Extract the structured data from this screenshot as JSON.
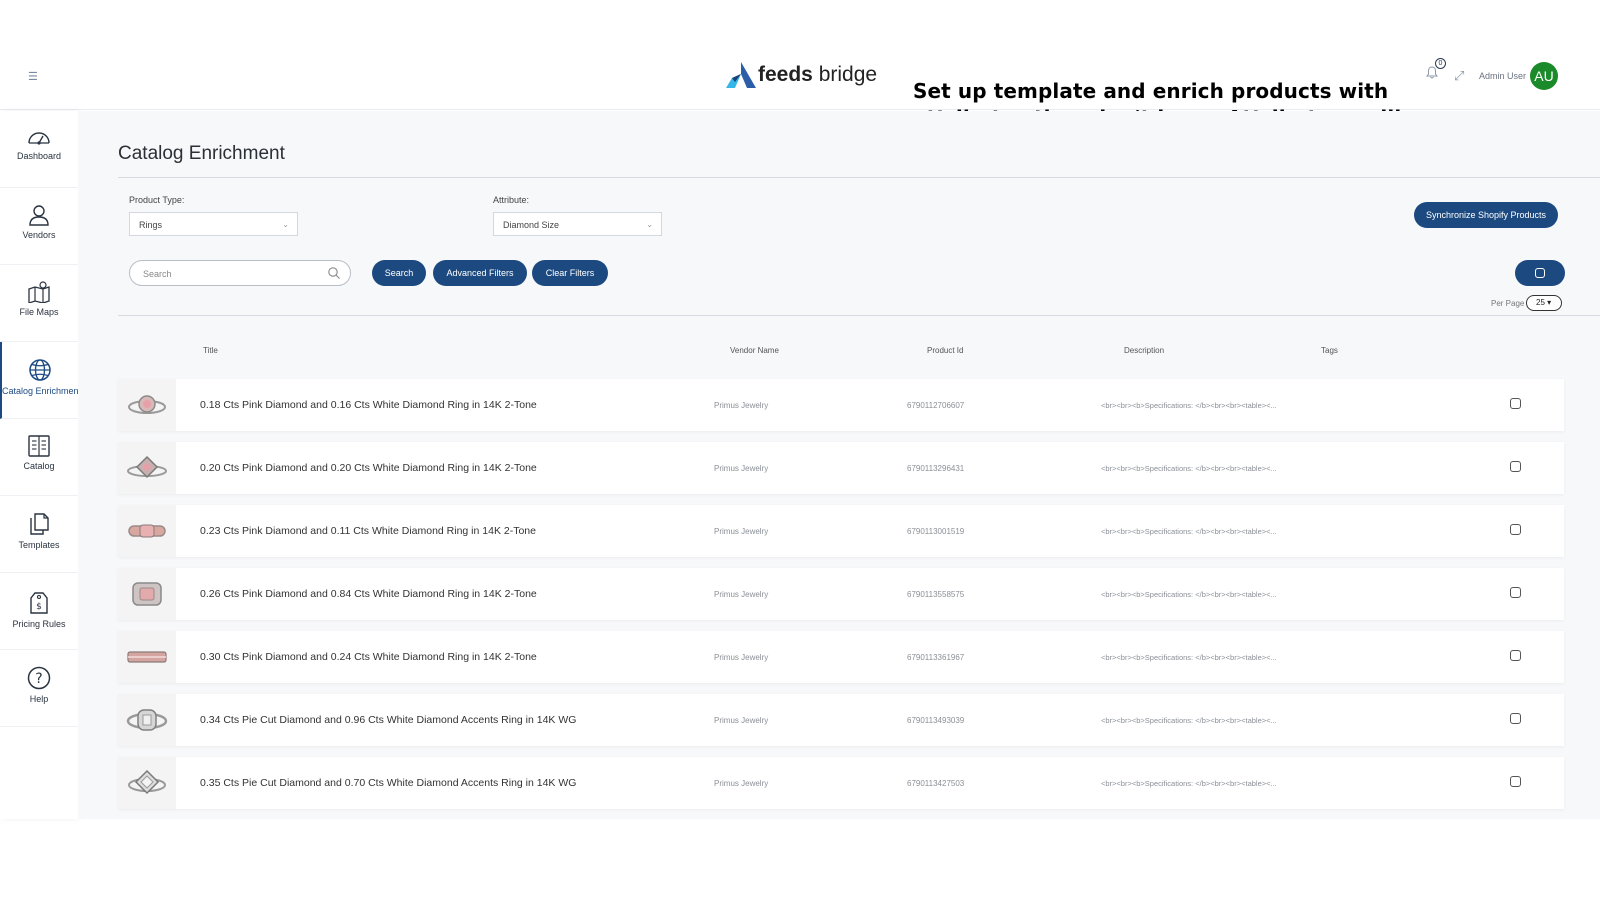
{
  "header": {
    "logo_strong": "feeds",
    "logo_light": " bridge",
    "annotation": "Set up template and enrich products with attributes they don't have. Attributess will  be created as tags on shopify in the following format \"Diamond Size_1-2Ctw\". This enrichment will make your products more visible on products listing page.",
    "notification_count": "0",
    "user_name": "Admin User",
    "user_initials": "AU"
  },
  "sidebar": {
    "items": [
      {
        "label": "Dashboard",
        "icon": "dashboard-icon"
      },
      {
        "label": "Vendors",
        "icon": "vendors-icon"
      },
      {
        "label": "File Maps",
        "icon": "file-maps-icon"
      },
      {
        "label": "Catalog Enrichment",
        "icon": "globe-icon"
      },
      {
        "label": "Catalog",
        "icon": "catalog-icon"
      },
      {
        "label": "Templates",
        "icon": "templates-icon"
      },
      {
        "label": "Pricing Rules",
        "icon": "price-tag-icon"
      },
      {
        "label": "Help",
        "icon": "help-icon"
      }
    ],
    "active": "Catalog Enrichment"
  },
  "page": {
    "title": "Catalog Enrichment",
    "product_type_label": "Product Type:",
    "product_type_value": "Rings",
    "attribute_label": "Attribute:",
    "attribute_value": "Diamond Size",
    "sync_button": "Synchronize Shopify Products",
    "search_placeholder": "Search",
    "search_button": "Search",
    "advanced_filters_button": "Advanced Filters",
    "clear_filters_button": "Clear Filters",
    "per_page_label": "Per Page",
    "per_page_value": "25"
  },
  "table": {
    "headers": {
      "title": "Title",
      "vendor": "Vendor Name",
      "product_id": "Product Id",
      "description": "Description",
      "tags": "Tags"
    },
    "rows": [
      {
        "title": "0.18 Cts Pink Diamond and 0.16 Cts White Diamond Ring in 14K 2-Tone",
        "vendor": "Primus Jewelry",
        "product_id": "6790112706607",
        "description": "<br><br><b>Specifications: </b><br><br><table><..."
      },
      {
        "title": "0.20 Cts Pink Diamond and 0.20 Cts White Diamond Ring in 14K 2-Tone",
        "vendor": "Primus Jewelry",
        "product_id": "6790113296431",
        "description": "<br><br><b>Specifications: </b><br><br><table><..."
      },
      {
        "title": "0.23 Cts Pink Diamond and 0.11 Cts White Diamond Ring in 14K 2-Tone",
        "vendor": "Primus Jewelry",
        "product_id": "6790113001519",
        "description": "<br><br><b>Specifications: </b><br><br><table><..."
      },
      {
        "title": "0.26 Cts Pink Diamond and 0.84 Cts White Diamond Ring in 14K 2-Tone",
        "vendor": "Primus Jewelry",
        "product_id": "6790113558575",
        "description": "<br><br><b>Specifications: </b><br><br><table><..."
      },
      {
        "title": "0.30 Cts Pink Diamond and 0.24 Cts White Diamond Ring in 14K 2-Tone",
        "vendor": "Primus Jewelry",
        "product_id": "6790113361967",
        "description": "<br><br><b>Specifications: </b><br><br><table><..."
      },
      {
        "title": "0.34 Cts Pie Cut Diamond and 0.96 Cts White Diamond Accents Ring in 14K WG",
        "vendor": "Primus Jewelry",
        "product_id": "6790113493039",
        "description": "<br><br><b>Specifications: </b><br><br><table><..."
      },
      {
        "title": "0.35 Cts Pie Cut Diamond and 0.70 Cts White Diamond Accents Ring in 14K WG",
        "vendor": "Primus Jewelry",
        "product_id": "6790113427503",
        "description": "<br><br><b>Specifications: </b><br><br><table><..."
      }
    ]
  },
  "colors": {
    "primary": "#1c4a80",
    "avatar": "#1a8a2a",
    "logo_blue": "#2a5fa8",
    "logo_cyan": "#35b6e8"
  }
}
